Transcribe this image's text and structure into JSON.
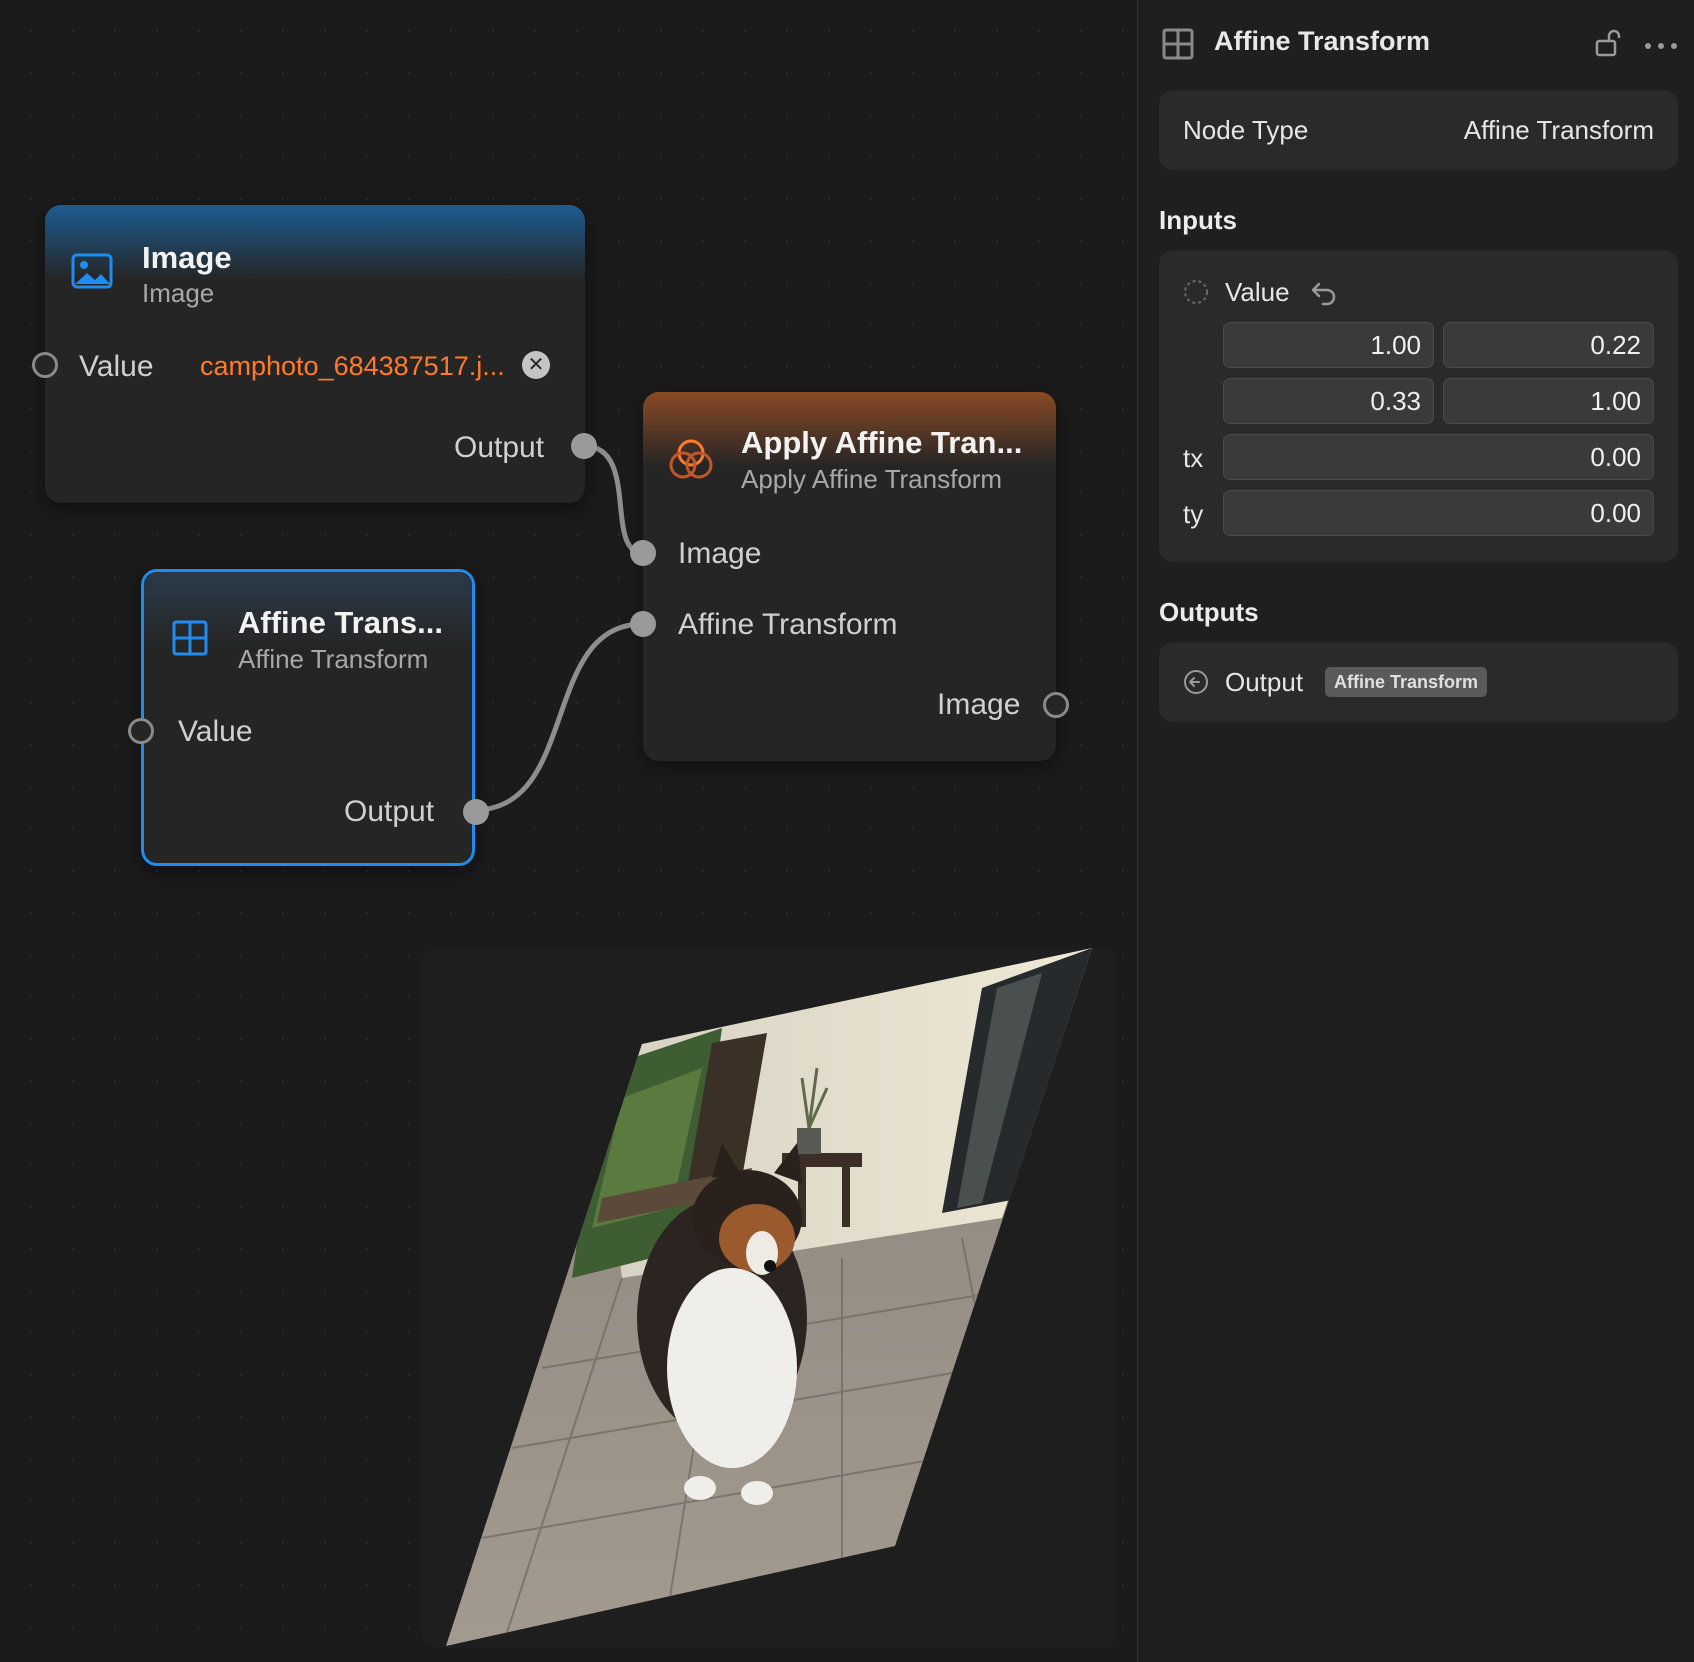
{
  "nodes": {
    "image": {
      "title": "Image",
      "subtitle": "Image",
      "value_label": "Value",
      "file_name": "camphoto_684387517.j...",
      "output_label": "Output"
    },
    "apply": {
      "title": "Apply Affine Tran...",
      "subtitle": "Apply Affine Transform",
      "input_image": "Image",
      "input_transform": "Affine Transform",
      "output_label": "Image"
    },
    "affine": {
      "title": "Affine Trans...",
      "subtitle": "Affine Transform",
      "value_label": "Value",
      "output_label": "Output"
    }
  },
  "inspector": {
    "title": "Affine Transform",
    "node_type_label": "Node Type",
    "node_type_value": "Affine Transform",
    "inputs_title": "Inputs",
    "value_label": "Value",
    "matrix": [
      "1.00",
      "0.22",
      "0.33",
      "1.00"
    ],
    "tx_label": "tx",
    "tx_value": "0.00",
    "ty_label": "ty",
    "ty_value": "0.00",
    "outputs_title": "Outputs",
    "output_label": "Output",
    "output_type_badge": "Affine Transform"
  },
  "colors": {
    "selection": "#1e8cf0",
    "file_text": "#ff7a29",
    "image_header": "#1d5d92",
    "apply_header": "#8a4a25"
  },
  "icons": [
    "image-icon",
    "grid-icon",
    "overlap-circles-icon",
    "clear-icon",
    "lock-open-icon",
    "more-icon",
    "reset-icon",
    "output-arrow-icon"
  ]
}
